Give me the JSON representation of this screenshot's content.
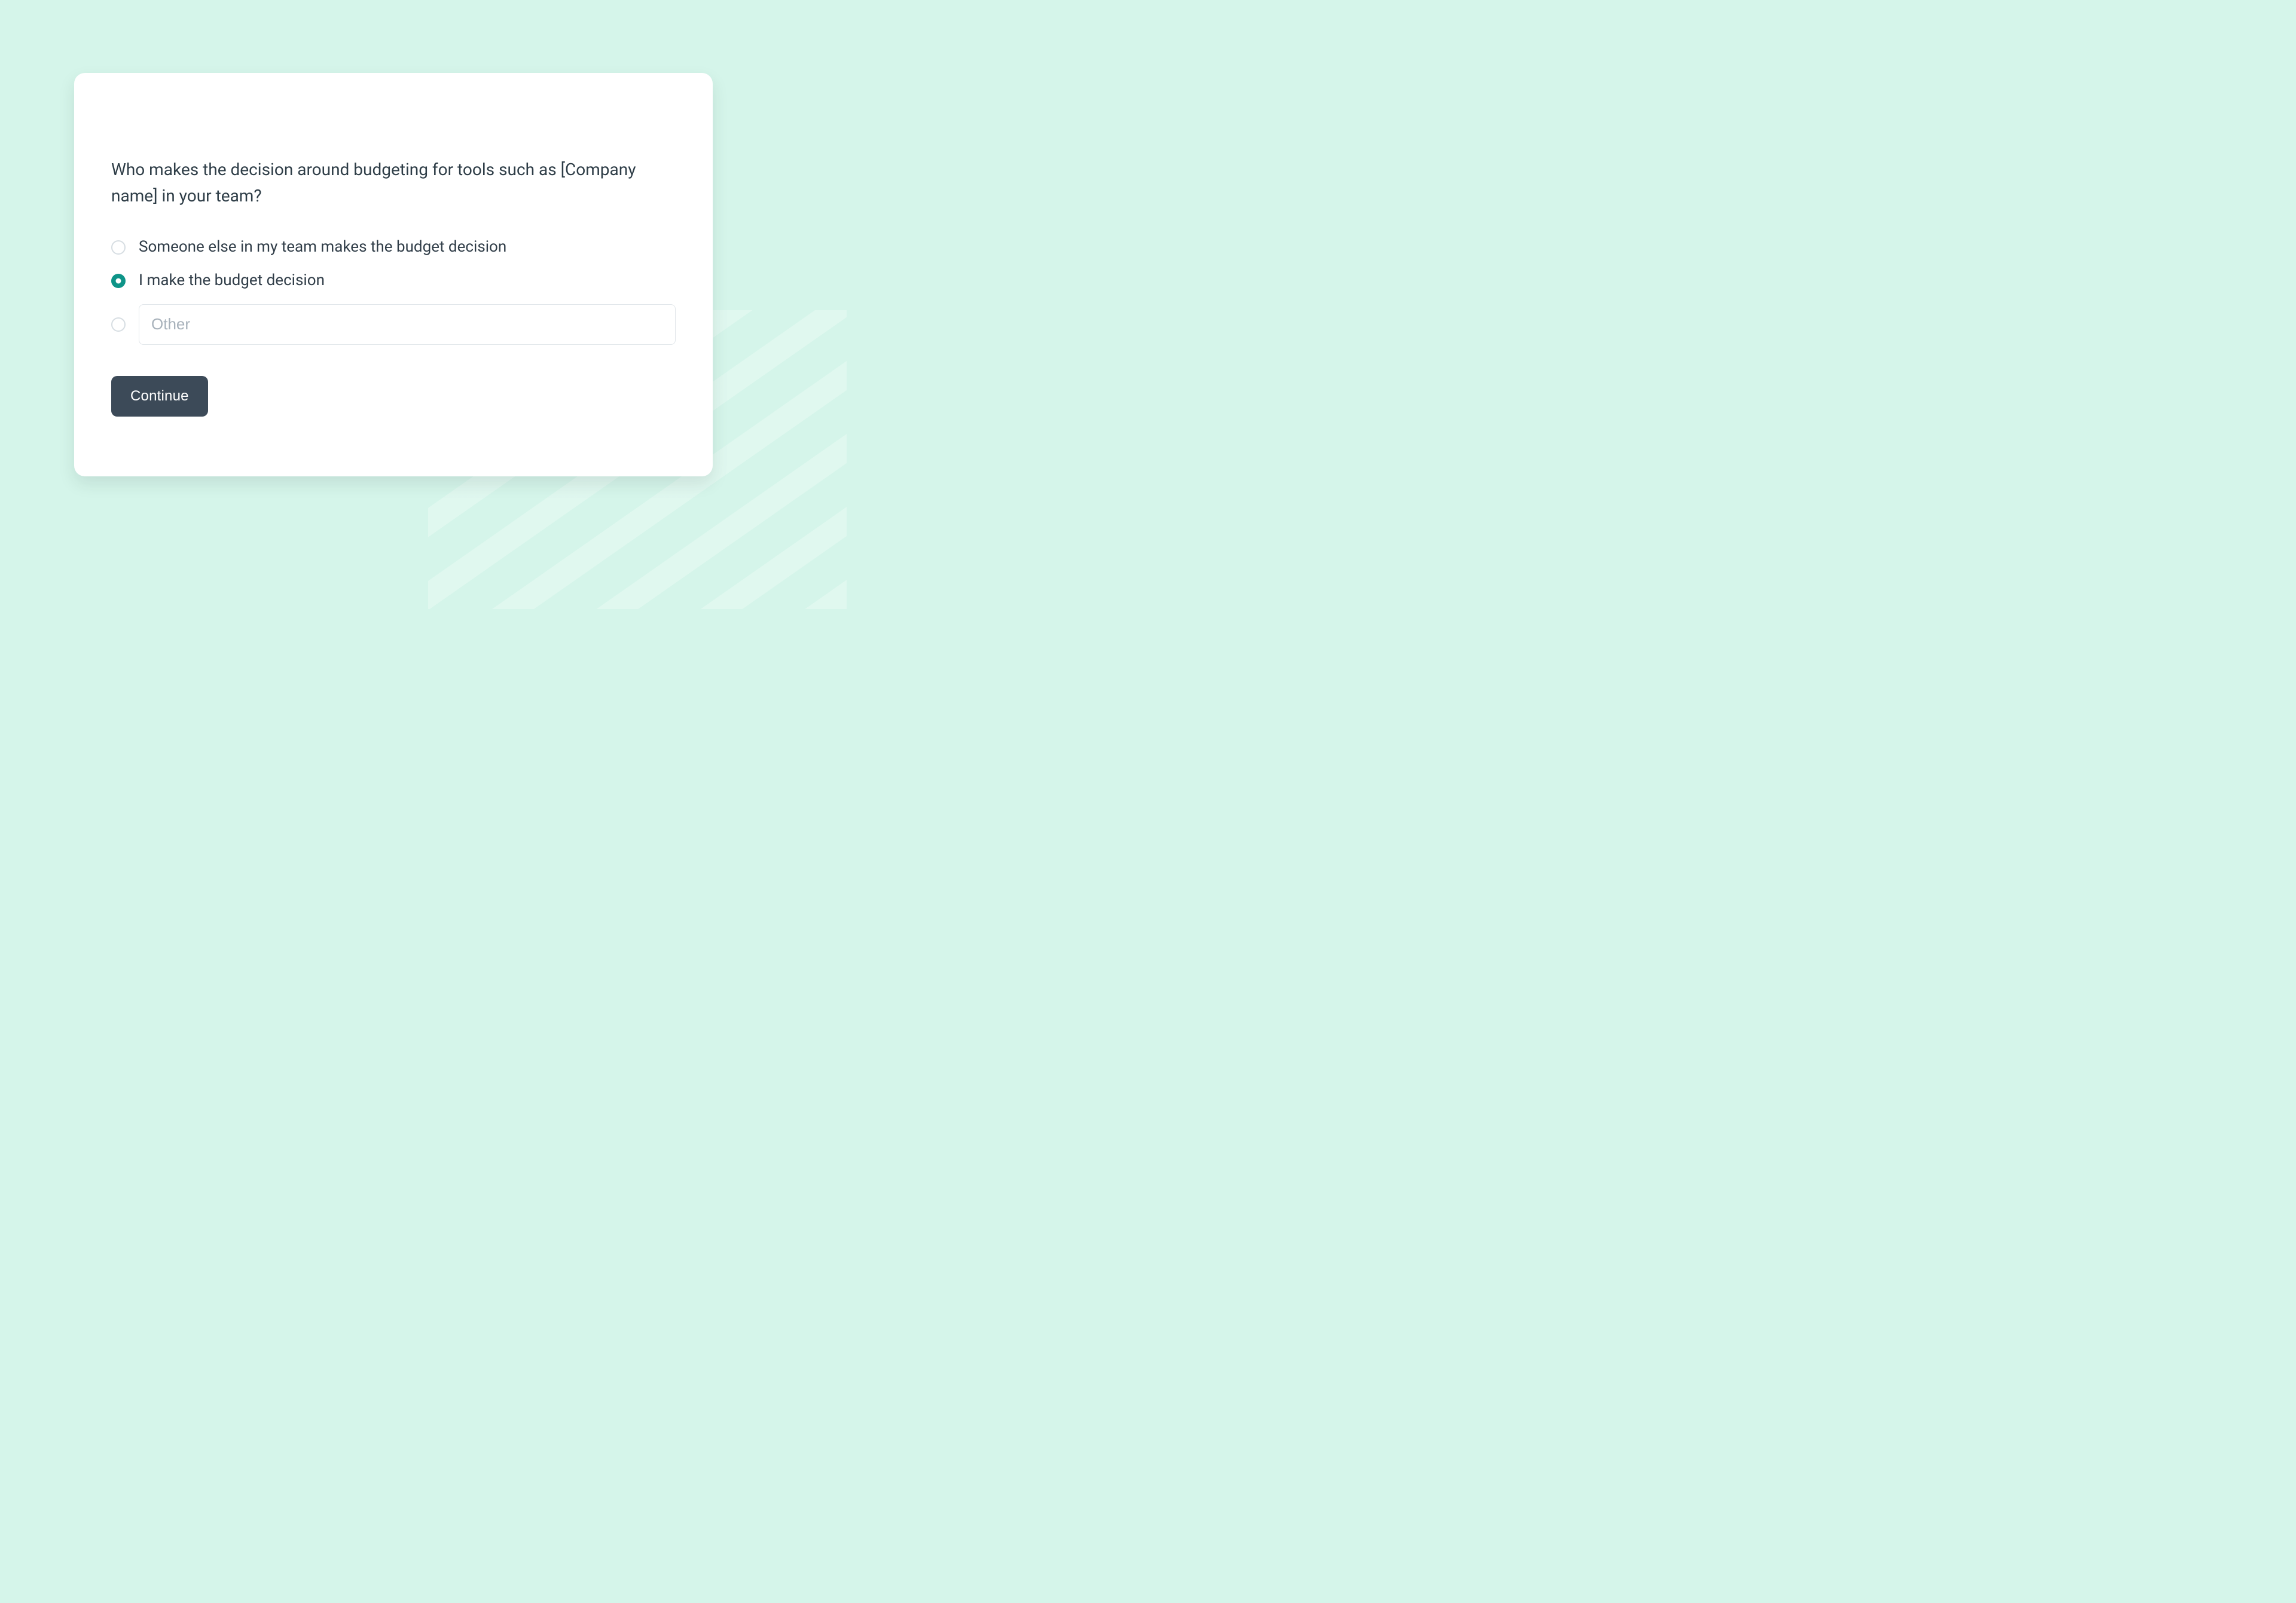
{
  "question": "Who makes the decision around budgeting for tools such as [Company name] in your team?",
  "options": [
    {
      "label": "Someone else in my team makes the budget decision",
      "selected": false,
      "has_text_input": false
    },
    {
      "label": "I make the budget decision",
      "selected": true,
      "has_text_input": false
    },
    {
      "label": "",
      "selected": false,
      "has_text_input": true,
      "placeholder": "Other",
      "value": ""
    }
  ],
  "continue_label": "Continue",
  "colors": {
    "background": "#d5f5ea",
    "card": "#ffffff",
    "text": "#2e3d47",
    "radio_border": "#d6dde2",
    "radio_selected": "#0e9488",
    "input_border": "#e1e6ea",
    "placeholder": "#a8b2bb",
    "button_bg": "#3c4a58",
    "button_text": "#ffffff"
  }
}
